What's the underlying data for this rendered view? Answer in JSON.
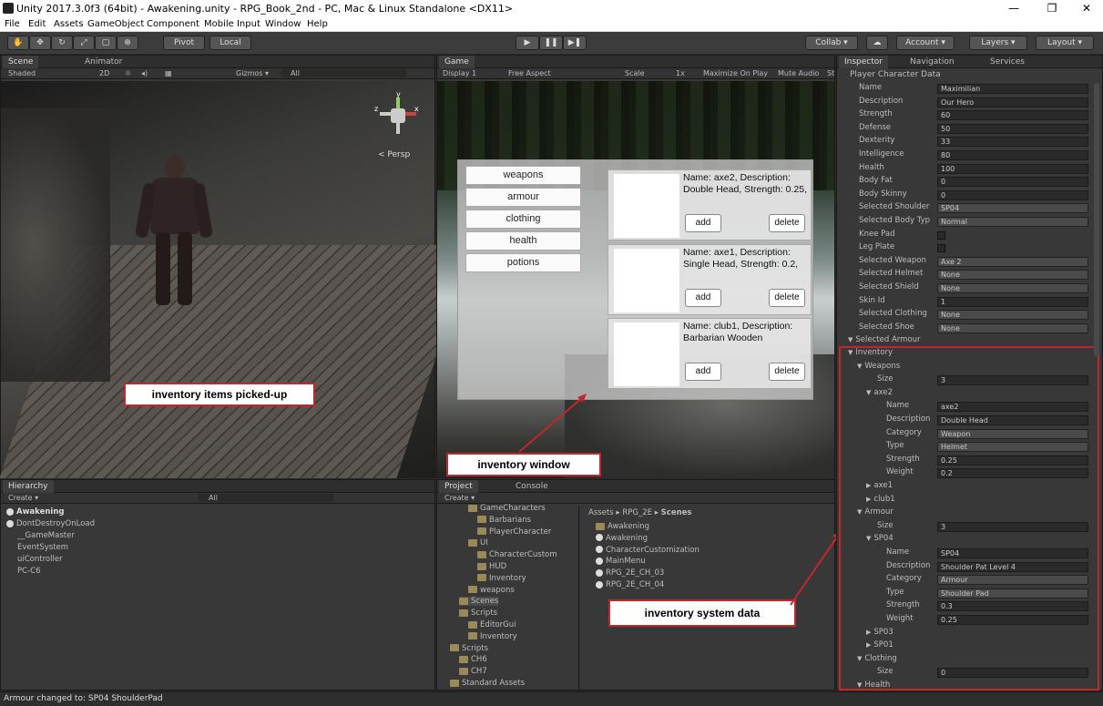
{
  "window": {
    "title": "Unity 2017.3.0f3 (64bit) - Awakening.unity - RPG_Book_2nd - PC, Mac & Linux Standalone <DX11>",
    "minimize": "—",
    "maximize": "❐",
    "close": "✕"
  },
  "menu": [
    "File",
    "Edit",
    "Assets",
    "GameObject",
    "Component",
    "Mobile Input",
    "Window",
    "Help"
  ],
  "toolbar": {
    "pivot": "Pivot",
    "local": "Local",
    "collab": "Collab ▾",
    "account": "Account ▾",
    "layers": "Layers ▾",
    "layout": "Layout ▾"
  },
  "scene": {
    "tabs": [
      "Scene",
      "Animator"
    ],
    "shaded": "Shaded",
    "mode2d": "2D",
    "gizmos": "Gizmos ▾",
    "search": "All",
    "persp": "Persp",
    "gizmo_axes": {
      "y": "y",
      "x": "x",
      "z": "z"
    }
  },
  "game": {
    "tab": "Game",
    "display": "Display 1",
    "aspect": "Free Aspect",
    "scale_label": "Scale",
    "scale_value": "1x",
    "maximize": "Maximize On Play",
    "mute": "Mute Audio",
    "stats": "St",
    "categories": [
      "weapons",
      "armour",
      "clothing",
      "health",
      "potions"
    ],
    "items": [
      {
        "text": "Name: axe2, Description: Double Head, Strength: 0.25,",
        "add": "add",
        "delete": "delete"
      },
      {
        "text": "Name: axe1, Description: Single Head, Strength: 0.2,",
        "add": "add",
        "delete": "delete"
      },
      {
        "text": "Name: club1, Description: Barbarian Wooden",
        "add": "add",
        "delete": "delete"
      }
    ]
  },
  "callouts": {
    "picked": "inventory items picked-up",
    "window": "inventory window",
    "system": "inventory system data"
  },
  "hierarchy": {
    "tab": "Hierarchy",
    "create": "Create ▾",
    "search": "All",
    "items": [
      {
        "label": "Awakening",
        "indent": 0
      },
      {
        "label": "DontDestroyOnLoad",
        "indent": 0
      },
      {
        "label": "__GameMaster",
        "indent": 1
      },
      {
        "label": "EventSystem",
        "indent": 1
      },
      {
        "label": "uiController",
        "indent": 1
      },
      {
        "label": "PC-C6",
        "indent": 1
      }
    ]
  },
  "project": {
    "tabs": [
      "Project",
      "Console"
    ],
    "create": "Create ▾",
    "tree": [
      {
        "label": "GameCharacters",
        "indent": 3
      },
      {
        "label": "Barbarians",
        "indent": 4
      },
      {
        "label": "PlayerCharacter",
        "indent": 4
      },
      {
        "label": "UI",
        "indent": 3
      },
      {
        "label": "CharacterCustom",
        "indent": 4
      },
      {
        "label": "HUD",
        "indent": 4
      },
      {
        "label": "Inventory",
        "indent": 4
      },
      {
        "label": "weapons",
        "indent": 3
      },
      {
        "label": "Scenes",
        "indent": 2
      },
      {
        "label": "Scripts",
        "indent": 2
      },
      {
        "label": "EditorGui",
        "indent": 3
      },
      {
        "label": "Inventory",
        "indent": 3
      },
      {
        "label": "Scripts",
        "indent": 1
      },
      {
        "label": "CH6",
        "indent": 2
      },
      {
        "label": "CH7",
        "indent": 2
      },
      {
        "label": "Standard Assets",
        "indent": 1
      }
    ],
    "breadcrumb": [
      "Assets",
      "RPG_2E",
      "Scenes"
    ],
    "files": [
      "Awakening",
      "Awakening",
      "CharacterCustomization",
      "MainMenu",
      "RPG_2E_CH_03",
      "RPG_2E_CH_04"
    ]
  },
  "inspector": {
    "tabs": [
      "Inspector",
      "Navigation",
      "Services"
    ],
    "header": "Player Character Data",
    "fields": [
      {
        "label": "Name",
        "value": "Maximilian",
        "kind": "text"
      },
      {
        "label": "Description",
        "value": "Our Hero",
        "kind": "text"
      },
      {
        "label": "Strength",
        "value": "60",
        "kind": "text"
      },
      {
        "label": "Defense",
        "value": "50",
        "kind": "text"
      },
      {
        "label": "Dexterity",
        "value": "33",
        "kind": "text"
      },
      {
        "label": "Intelligence",
        "value": "80",
        "kind": "text"
      },
      {
        "label": "Health",
        "value": "100",
        "kind": "text"
      },
      {
        "label": "Body Fat",
        "value": "0",
        "kind": "text"
      },
      {
        "label": "Body Skinny",
        "value": "0",
        "kind": "text"
      },
      {
        "label": "Selected Shoulder",
        "value": "SP04",
        "kind": "drop"
      },
      {
        "label": "Selected Body Typ",
        "value": "Normal",
        "kind": "drop"
      },
      {
        "label": "Knee Pad",
        "value": "",
        "kind": "check"
      },
      {
        "label": "Leg Plate",
        "value": "",
        "kind": "check"
      },
      {
        "label": "Selected Weapon",
        "value": "Axe 2",
        "kind": "drop"
      },
      {
        "label": "Selected Helmet",
        "value": "None",
        "kind": "drop"
      },
      {
        "label": "Selected Shield",
        "value": "None",
        "kind": "drop"
      },
      {
        "label": "Skin Id",
        "value": "1",
        "kind": "text"
      },
      {
        "label": "Selected Clothing",
        "value": "None",
        "kind": "drop"
      },
      {
        "label": "Selected Shoe",
        "value": "None",
        "kind": "drop"
      },
      {
        "label": "Selected Armour",
        "value": "",
        "kind": "fold"
      }
    ],
    "inventory": [
      {
        "label": "Inventory",
        "value": "",
        "kind": "fold",
        "indent": 0
      },
      {
        "label": "Weapons",
        "value": "",
        "kind": "fold",
        "indent": 1
      },
      {
        "label": "Size",
        "value": "3",
        "kind": "text",
        "indent": 2
      },
      {
        "label": "axe2",
        "value": "",
        "kind": "fold",
        "indent": 2
      },
      {
        "label": "Name",
        "value": "axe2",
        "kind": "text",
        "indent": 3
      },
      {
        "label": "Description",
        "value": "Double Head",
        "kind": "text",
        "indent": 3
      },
      {
        "label": "Category",
        "value": "Weapon",
        "kind": "drop",
        "indent": 3
      },
      {
        "label": "Type",
        "value": "Helmet",
        "kind": "drop",
        "indent": 3
      },
      {
        "label": "Strength",
        "value": "0.25",
        "kind": "text",
        "indent": 3
      },
      {
        "label": "Weight",
        "value": "0.2",
        "kind": "text",
        "indent": 3
      },
      {
        "label": "axe1",
        "value": "",
        "kind": "foldc",
        "indent": 2
      },
      {
        "label": "club1",
        "value": "",
        "kind": "foldc",
        "indent": 2
      },
      {
        "label": "Armour",
        "value": "",
        "kind": "fold",
        "indent": 1
      },
      {
        "label": "Size",
        "value": "3",
        "kind": "text",
        "indent": 2
      },
      {
        "label": "SP04",
        "value": "",
        "kind": "fold",
        "indent": 2
      },
      {
        "label": "Name",
        "value": "SP04",
        "kind": "text",
        "indent": 3
      },
      {
        "label": "Description",
        "value": "Shoulder Pat Level 4",
        "kind": "text",
        "indent": 3
      },
      {
        "label": "Category",
        "value": "Armour",
        "kind": "drop",
        "indent": 3
      },
      {
        "label": "Type",
        "value": "Shoulder Pad",
        "kind": "drop",
        "indent": 3
      },
      {
        "label": "Strength",
        "value": "0.3",
        "kind": "text",
        "indent": 3
      },
      {
        "label": "Weight",
        "value": "0.25",
        "kind": "text",
        "indent": 3
      },
      {
        "label": "SP03",
        "value": "",
        "kind": "foldc",
        "indent": 2
      },
      {
        "label": "SP01",
        "value": "",
        "kind": "foldc",
        "indent": 2
      },
      {
        "label": "Clothing",
        "value": "",
        "kind": "fold",
        "indent": 1
      },
      {
        "label": "Size",
        "value": "0",
        "kind": "text",
        "indent": 2
      },
      {
        "label": "Health",
        "value": "",
        "kind": "fold",
        "indent": 1
      }
    ]
  },
  "status": "Armour changed to: SP04 ShoulderPad",
  "colors": {
    "accent_red": "#c1272d",
    "panel": "#383838",
    "field": "#2a2a2a"
  }
}
